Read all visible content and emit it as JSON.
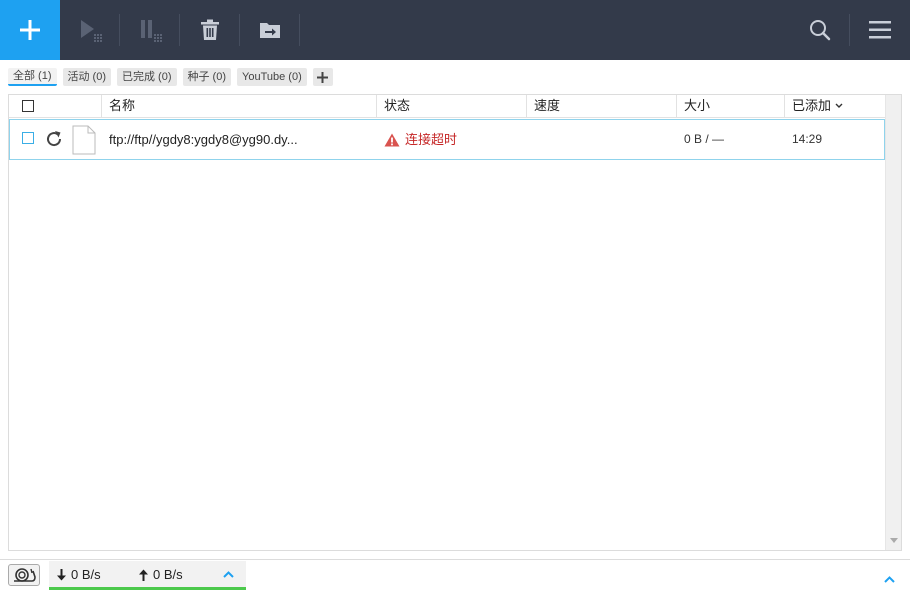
{
  "toolbar": {
    "buttons": [
      {
        "name": "add-button",
        "icon": "plus-icon"
      },
      {
        "name": "resume-button",
        "icon": "play-icon"
      },
      {
        "name": "pause-button",
        "icon": "pause-icon"
      },
      {
        "name": "delete-button",
        "icon": "trash-icon"
      },
      {
        "name": "move-button",
        "icon": "folder-move-icon"
      },
      {
        "name": "search-button",
        "icon": "search-icon"
      },
      {
        "name": "menu-button",
        "icon": "hamburger-menu-icon"
      }
    ],
    "colors": {
      "background": "#333a4a",
      "accent": "#1ea1f1"
    }
  },
  "tabs": [
    {
      "label": "全部 (1)",
      "active": true
    },
    {
      "label": "活动 (0)",
      "active": false
    },
    {
      "label": "已完成 (0)",
      "active": false
    },
    {
      "label": "种子 (0)",
      "active": false
    },
    {
      "label": "YouTube (0)",
      "active": false
    }
  ],
  "columns": {
    "name": "名称",
    "status": "状态",
    "speed": "速度",
    "size": "大小",
    "added": "已添加"
  },
  "rows": [
    {
      "name": "ftp://ftp//ygdy8:ygdy8@yg90.dy...",
      "status": "连接超时",
      "speed": "",
      "size": "0 B / —",
      "added": "14:29"
    }
  ],
  "statusbar": {
    "download_speed": "0 B/s",
    "upload_speed": "0 B/s",
    "status_color": "#4cc94c"
  }
}
